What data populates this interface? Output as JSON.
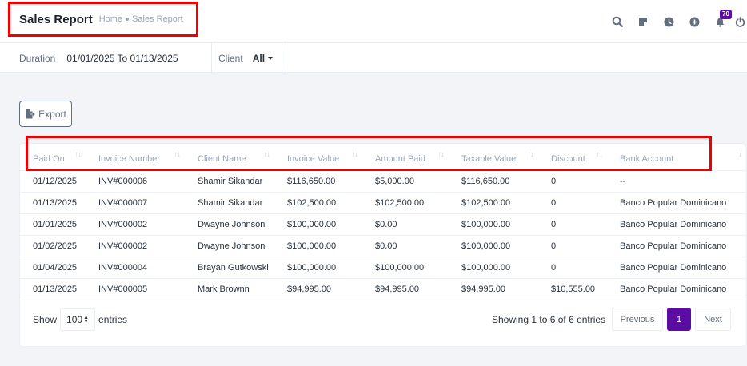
{
  "header": {
    "title": "Sales Report",
    "breadcrumb": [
      "Home",
      "Sales Report"
    ],
    "notification_count": "70"
  },
  "filters": {
    "duration_label": "Duration",
    "duration_value": "01/01/2025 To 01/13/2025",
    "client_label": "Client",
    "client_value": "All"
  },
  "export_label": "Export",
  "table": {
    "columns": [
      "Paid On",
      "Invoice Number",
      "Client Name",
      "Invoice Value",
      "Amount Paid",
      "Taxable Value",
      "Discount",
      "Bank Account"
    ],
    "rows": [
      [
        "01/12/2025",
        "INV#000006",
        "Shamir Sikandar",
        "$116,650.00",
        "$5,000.00",
        "$116,650.00",
        "0",
        "--"
      ],
      [
        "01/13/2025",
        "INV#000007",
        "Shamir Sikandar",
        "$102,500.00",
        "$102,500.00",
        "$102,500.00",
        "0",
        "Banco Popular Dominicano"
      ],
      [
        "01/01/2025",
        "INV#000002",
        "Dwayne Johnson",
        "$100,000.00",
        "$0.00",
        "$100,000.00",
        "0",
        "Banco Popular Dominicano"
      ],
      [
        "01/02/2025",
        "INV#000002",
        "Dwayne Johnson",
        "$100,000.00",
        "$0.00",
        "$100,000.00",
        "0",
        "Banco Popular Dominicano"
      ],
      [
        "01/04/2025",
        "INV#000004",
        "Brayan Gutkowski",
        "$100,000.00",
        "$100,000.00",
        "$100,000.00",
        "0",
        "Banco Popular Dominicano"
      ],
      [
        "01/13/2025",
        "INV#000005",
        "Mark Brownn",
        "$94,995.00",
        "$94,995.00",
        "$94,995.00",
        "$10,555.00",
        "Banco Popular Dominicano"
      ]
    ]
  },
  "footer": {
    "show_label": "Show",
    "entries_value": "100",
    "entries_label": "entries",
    "showing_text": "Showing 1 to 6 of 6 entries",
    "previous_label": "Previous",
    "page_number": "1",
    "next_label": "Next"
  },
  "colors": {
    "accent": "#5b0da3",
    "highlight_border": "#ee0000"
  }
}
